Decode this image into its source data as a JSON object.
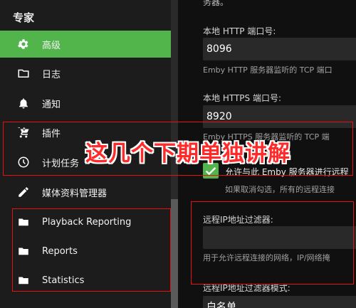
{
  "sidebar": {
    "section_title": "专家",
    "items": [
      {
        "label": "高级",
        "icon": "gear-icon",
        "active": true
      },
      {
        "label": "日志",
        "icon": "folder-outline-icon"
      },
      {
        "label": "通知",
        "icon": "bell-icon"
      },
      {
        "label": "插件",
        "icon": "cart-plus-icon"
      },
      {
        "label": "计划任务",
        "icon": "clock-icon"
      },
      {
        "label": "媒体资料管理器",
        "icon": "pencil-icon"
      },
      {
        "label": "Playback Reporting",
        "icon": "folder-icon"
      },
      {
        "label": "Reports",
        "icon": "folder-icon"
      },
      {
        "label": "Statistics",
        "icon": "folder-icon"
      }
    ]
  },
  "main": {
    "top_cut_text": "务器。",
    "http_port": {
      "label": "本地 HTTP 端口号:",
      "value": "8096",
      "help": "Emby HTTP 服务器监听的 TCP 端口"
    },
    "https_port": {
      "label": "本地 HTTPS 端口号:",
      "value": "8920",
      "help": "Emby HTTPS 服务器监听的 TCP 端"
    },
    "remote_access": {
      "label": "允许与此 Emby 服务器进行远程",
      "help": "如果取消勾选，所有的远程连接"
    },
    "ip_filter": {
      "label": "远程IP地址过滤器:",
      "value": "",
      "help": "用于允许远程连接的网络，IP/网络掩"
    },
    "ip_filter_mode": {
      "label": "远程IP地址过滤器模式:",
      "value": "白名单"
    }
  },
  "annotation": {
    "text": "这几个下期单独讲解"
  },
  "colors": {
    "accent": "#52b54b",
    "annotation": "#e81010"
  }
}
